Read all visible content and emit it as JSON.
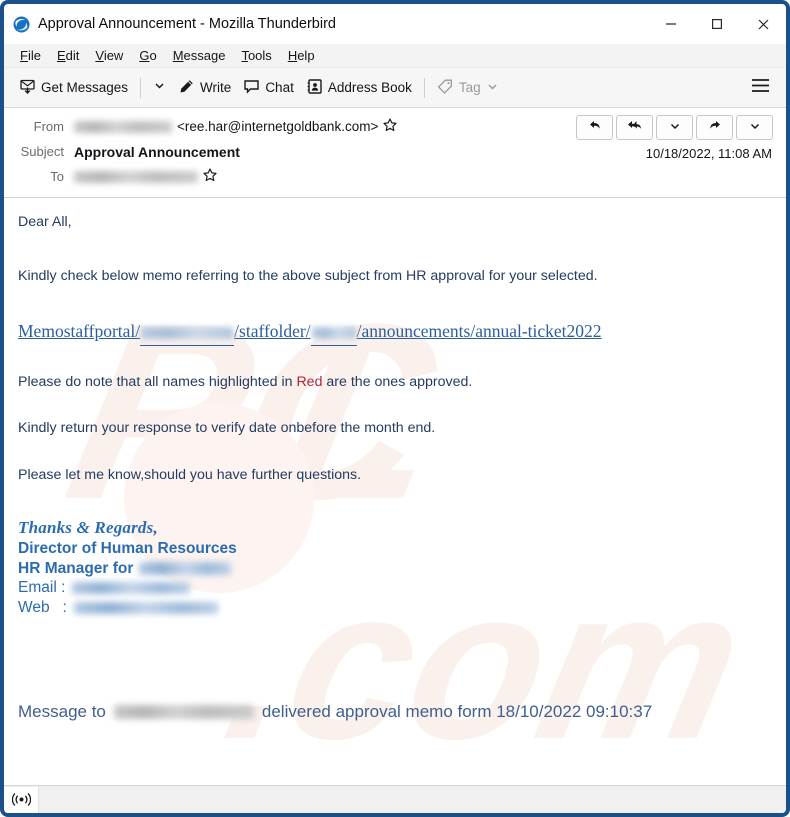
{
  "window": {
    "title": "Approval Announcement - Mozilla Thunderbird",
    "logo_icon": "thunderbird-logo-icon",
    "controls": {
      "minimize": "minimize-icon",
      "maximize": "maximize-icon",
      "close": "close-icon"
    },
    "frame_color": "#1b5089"
  },
  "menubar": {
    "items": [
      {
        "accel": "F",
        "rest": "ile"
      },
      {
        "accel": "E",
        "rest": "dit"
      },
      {
        "accel": "V",
        "rest": "iew"
      },
      {
        "accel": "G",
        "rest": "o"
      },
      {
        "accel": "M",
        "rest": "essage"
      },
      {
        "accel": "T",
        "rest": "ools"
      },
      {
        "accel": "H",
        "rest": "elp"
      }
    ]
  },
  "toolbar": {
    "get_messages_label": "Get Messages",
    "get_messages_icon": "get-messages-icon",
    "get_messages_dropdown_icon": "chevron-down-icon",
    "write_label": "Write",
    "write_icon": "pencil-icon",
    "chat_label": "Chat",
    "chat_icon": "chat-bubble-icon",
    "address_book_label": "Address Book",
    "address_book_icon": "address-book-icon",
    "tag_label": "Tag",
    "tag_icon": "tag-icon",
    "tag_dropdown_icon": "chevron-down-icon",
    "tag_disabled": true,
    "menu_icon": "hamburger-menu-icon"
  },
  "message_header": {
    "from_label": "From",
    "from_name_redacted": true,
    "from_address": "<ree.har@internetgoldbank.com>",
    "from_star_icon": "star-icon",
    "subject_label": "Subject",
    "subject_value": "Approval Announcement",
    "to_label": "To",
    "to_value_redacted": true,
    "to_star_icon": "star-icon",
    "date": "10/18/2022, 11:08 AM",
    "actions": [
      {
        "name": "reply-button",
        "icon": "reply-icon"
      },
      {
        "name": "reply-all-button",
        "icon": "reply-all-icon"
      },
      {
        "name": "reply-dropdown-button",
        "icon": "chevron-down-icon"
      },
      {
        "name": "forward-button",
        "icon": "forward-icon"
      },
      {
        "name": "more-actions-dropdown-button",
        "icon": "chevron-down-icon"
      }
    ]
  },
  "body": {
    "greeting": "Dear All,",
    "intro": "Kindly check below memo referring to the above subject from HR approval for your selected.",
    "link": {
      "part1": "Memostaffportal/",
      "redacted1": true,
      "part2": "/staffolder/",
      "redacted2": true,
      "part3": "/announcements/annual-ticket2022"
    },
    "note_before": "Please do note that all names highlighted in ",
    "note_red_word": "Red",
    "note_after": " are the ones approved.",
    "return_line": "Kindly return your response to verify date onbefore the month end.",
    "questions_line": "Please let me know,should you have further questions.",
    "red_color": "#b3243a",
    "text_color": "#243c61",
    "link_color": "#2a5f9e"
  },
  "signature": {
    "thanks": "Thanks & Regards,",
    "title_line": "Director of Human Resources",
    "manager_label": "HR Manager for",
    "manager_value_redacted": true,
    "email_label": "Email :",
    "email_value_redacted": true,
    "web_label": "Web   :",
    "web_value_redacted": true,
    "color": "#2b6cb0"
  },
  "footer": {
    "prefix": "Message to",
    "recipient_redacted": true,
    "suffix": "delivered approval memo form 18/10/2022 09:10:37"
  },
  "statusbar": {
    "icon": "broadcast-status-icon"
  },
  "watermark": {
    "text": "pcrisk.com",
    "color": "#faf0ec"
  }
}
